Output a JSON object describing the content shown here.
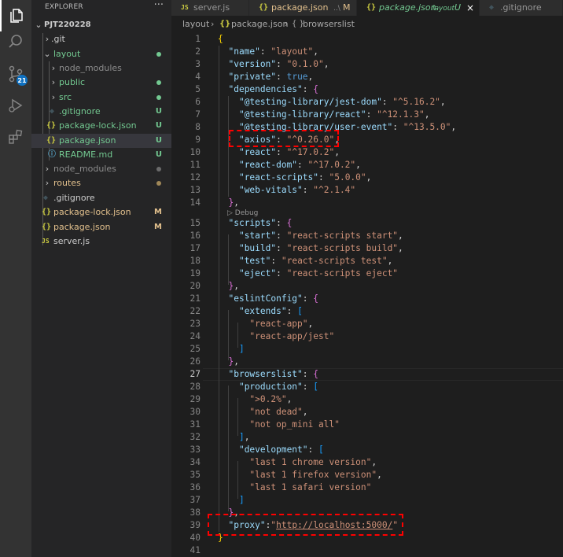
{
  "activity_bar": {
    "items": [
      {
        "icon": "files-icon",
        "active": true
      },
      {
        "icon": "search-icon",
        "active": false
      },
      {
        "icon": "source-control-icon",
        "active": false,
        "badge": "21"
      },
      {
        "icon": "run-debug-icon",
        "active": false
      },
      {
        "icon": "extensions-icon",
        "active": false
      }
    ]
  },
  "explorer": {
    "title": "EXPLORER",
    "more": "···",
    "root": "PJT220228",
    "items": [
      {
        "label": "git",
        "prefix": "."
      },
      {
        "label": "layout"
      },
      {
        "label": "node_modules"
      },
      {
        "label": "public"
      },
      {
        "label": "src"
      },
      {
        "label": ".gitignore",
        "decoration": "U"
      },
      {
        "label": "package-lock.json",
        "decoration": "U"
      },
      {
        "label": "package.json",
        "decoration": "U"
      },
      {
        "label": "README.md",
        "decoration": "U"
      },
      {
        "label": "node_modules"
      },
      {
        "label": "routes"
      },
      {
        "label": ".gitignore"
      },
      {
        "label": "package-lock.json",
        "decoration": "M"
      },
      {
        "label": "package.json",
        "decoration": "M"
      },
      {
        "label": "server.js"
      }
    ],
    "icons": {
      "json": "{}",
      "js": "JS",
      "info": "ⓘ",
      "git": "◆"
    },
    "colors": {
      "untracked": "#73c991",
      "modified": "#e2c08d",
      "ignored": "#8c8c8c"
    }
  },
  "tabs": [
    {
      "icon": "JS",
      "label": "server.js"
    },
    {
      "icon": "{}",
      "label": "package.json",
      "description": "..\\",
      "decoration": "M"
    },
    {
      "icon": "{}",
      "label": "package.json",
      "description": "layout",
      "decoration": "U",
      "close": "×"
    },
    {
      "icon": "◆",
      "label": ".gitignore"
    }
  ],
  "breadcrumb": {
    "parts": [
      "layout",
      "›",
      "{}",
      "package.json",
      "›",
      "{ }",
      "browserslist"
    ]
  },
  "editor": {
    "codelens": "▷ Debug",
    "line_numbers": [
      "1",
      "2",
      "3",
      "4",
      "5",
      "6",
      "7",
      "8",
      "9",
      "10",
      "11",
      "12",
      "13",
      "14",
      "15",
      "16",
      "17",
      "18",
      "19",
      "20",
      "21",
      "22",
      "23",
      "24",
      "25",
      "26",
      "27",
      "28",
      "29",
      "30",
      "31",
      "32",
      "33",
      "34",
      "35",
      "36",
      "37",
      "38",
      "39",
      "40",
      "41"
    ],
    "current_line": "27",
    "tokens": {
      "name_key": "\"name\"",
      "name_val": "\"layout\"",
      "version_key": "\"version\"",
      "version_val": "\"0.1.0\"",
      "private_key": "\"private\"",
      "private_val": "true",
      "dependencies_key": "\"dependencies\"",
      "dep1_key": "\"@testing-library/jest-dom\"",
      "dep1_val": "\"^5.16.2\"",
      "dep2_key": "\"@testing-library/react\"",
      "dep2_val": "\"^12.1.3\"",
      "dep3_key": "\"@testing-library/user-event\"",
      "dep3_val": "\"^13.5.0\"",
      "axios_key": "\"axios\"",
      "axios_val": "\"^0.26.0\"",
      "react_key": "\"react\"",
      "react_val": "\"^17.0.2\"",
      "reactdom_key": "\"react-dom\"",
      "reactdom_val": "\"^17.0.2\"",
      "reactscripts_key": "\"react-scripts\"",
      "reactscripts_val": "\"5.0.0\"",
      "webvitals_key": "\"web-vitals\"",
      "webvitals_val": "\"^2.1.4\"",
      "scripts_key": "\"scripts\"",
      "start_key": "\"start\"",
      "start_val": "\"react-scripts start\"",
      "build_key": "\"build\"",
      "build_val": "\"react-scripts build\"",
      "test_key": "\"test\"",
      "test_val": "\"react-scripts test\"",
      "eject_key": "\"eject\"",
      "eject_val": "\"react-scripts eject\"",
      "eslint_key": "\"eslintConfig\"",
      "extends_key": "\"extends\"",
      "ext1": "\"react-app\"",
      "ext2": "\"react-app/jest\"",
      "browserslist_key": "\"browserslist\"",
      "production_key": "\"production\"",
      "prod1": "\">0.2%\"",
      "prod2": "\"not dead\"",
      "prod3": "\"not op_mini all\"",
      "development_key": "\"development\"",
      "dev1": "\"last 1 chrome version\"",
      "dev2": "\"last 1 firefox version\"",
      "dev3": "\"last 1 safari version\"",
      "proxy_key": "\"proxy\"",
      "proxy_q1": "\"",
      "proxy_url": "http://localhost:5000/",
      "proxy_q2": "\""
    }
  },
  "colors": {
    "annotation": "#ff0000",
    "json_key": "#9cdcfe",
    "json_string": "#ce9178",
    "json_boolean": "#569cd6"
  }
}
